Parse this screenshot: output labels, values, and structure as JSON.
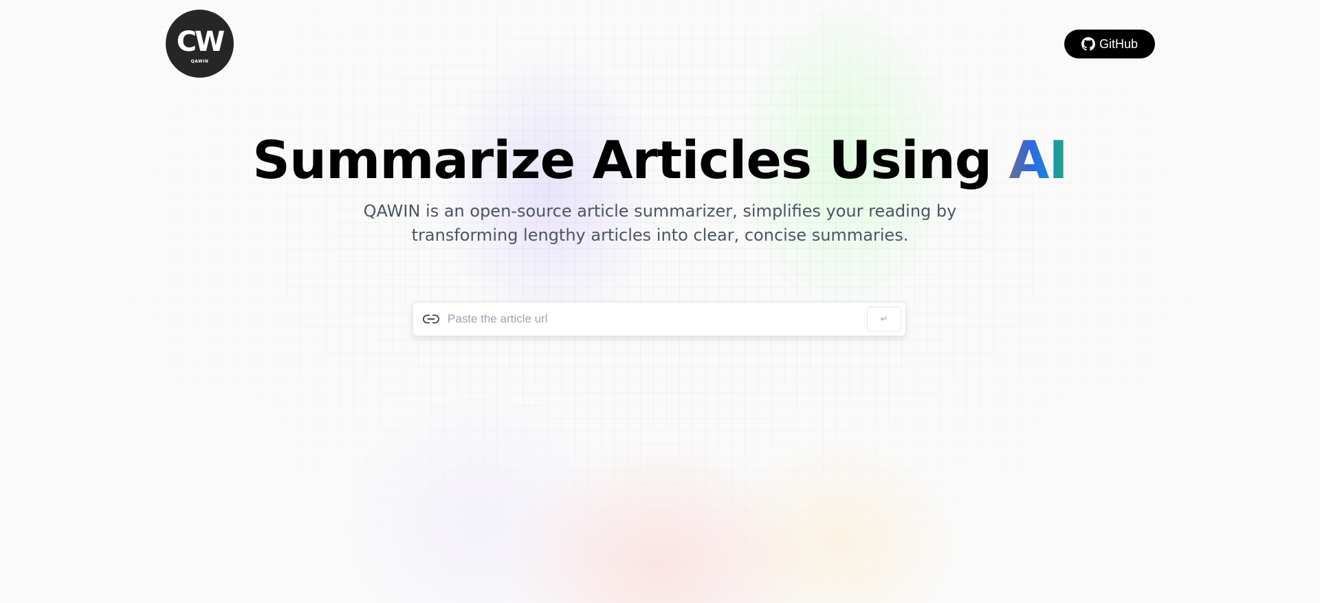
{
  "header": {
    "logo": {
      "mark": "CW",
      "subtext": "QAWIN",
      "icon": "qawin-logo"
    },
    "github_button": {
      "label": "GitHub",
      "icon": "github-icon"
    }
  },
  "hero": {
    "title_main": "Summarize Articles Using ",
    "title_accent": "AI",
    "subtitle": "QAWIN is an open-source article summarizer, simplifies your reading by transforming lengthy articles into clear, concise summaries."
  },
  "search": {
    "icon": "link-icon",
    "placeholder": "Paste the article url",
    "value": "",
    "submit_glyph": "↵",
    "submit_icon": "enter-icon"
  },
  "colors": {
    "background": "#fafafa",
    "logo_background": "#262626",
    "github_button_background": "#000000",
    "accent_gradient_start": "#6f6f86",
    "accent_gradient_mid": "#2f66e0",
    "accent_gradient_end": "#1fb069",
    "subtitle_text": "#4b5563"
  }
}
